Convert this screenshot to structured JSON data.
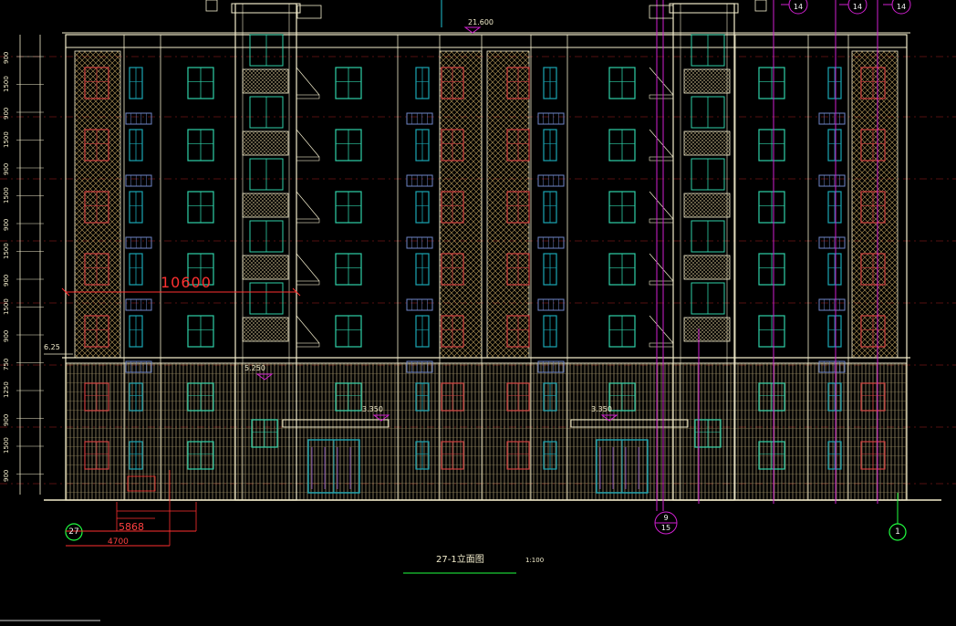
{
  "drawing": {
    "title": "27-1立面图",
    "scale": "1:100",
    "elevations": {
      "top": "21.600",
      "left_floor": "6.25",
      "podium": "5.250",
      "entrance_left": "3.350",
      "entrance_right": "3.350"
    },
    "dimensions": {
      "span_large": "10600",
      "span_mid": "5868",
      "span_small": "4700"
    },
    "left_dims": [
      "900",
      "1500",
      "900",
      "1500",
      "900",
      "1500",
      "900",
      "1500",
      "900",
      "1500",
      "900",
      "750",
      "1250",
      "900",
      "1500",
      "900"
    ],
    "axis_left": "27",
    "axis_right": "1",
    "grid_tags": [
      "14",
      "14",
      "14"
    ],
    "bottom_tag_top": "9",
    "bottom_tag_bottom": "15"
  },
  "colors": {
    "background": "#000000",
    "outline": "#f2eccb",
    "window_green": "#2fd0a8",
    "window_cyan": "#1aa6b4",
    "window_red": "#d04040",
    "dim_red": "#ff3030",
    "grid_magenta": "#d020d0",
    "axis_green": "#20ff40",
    "ac_blue": "#6f86c8"
  }
}
